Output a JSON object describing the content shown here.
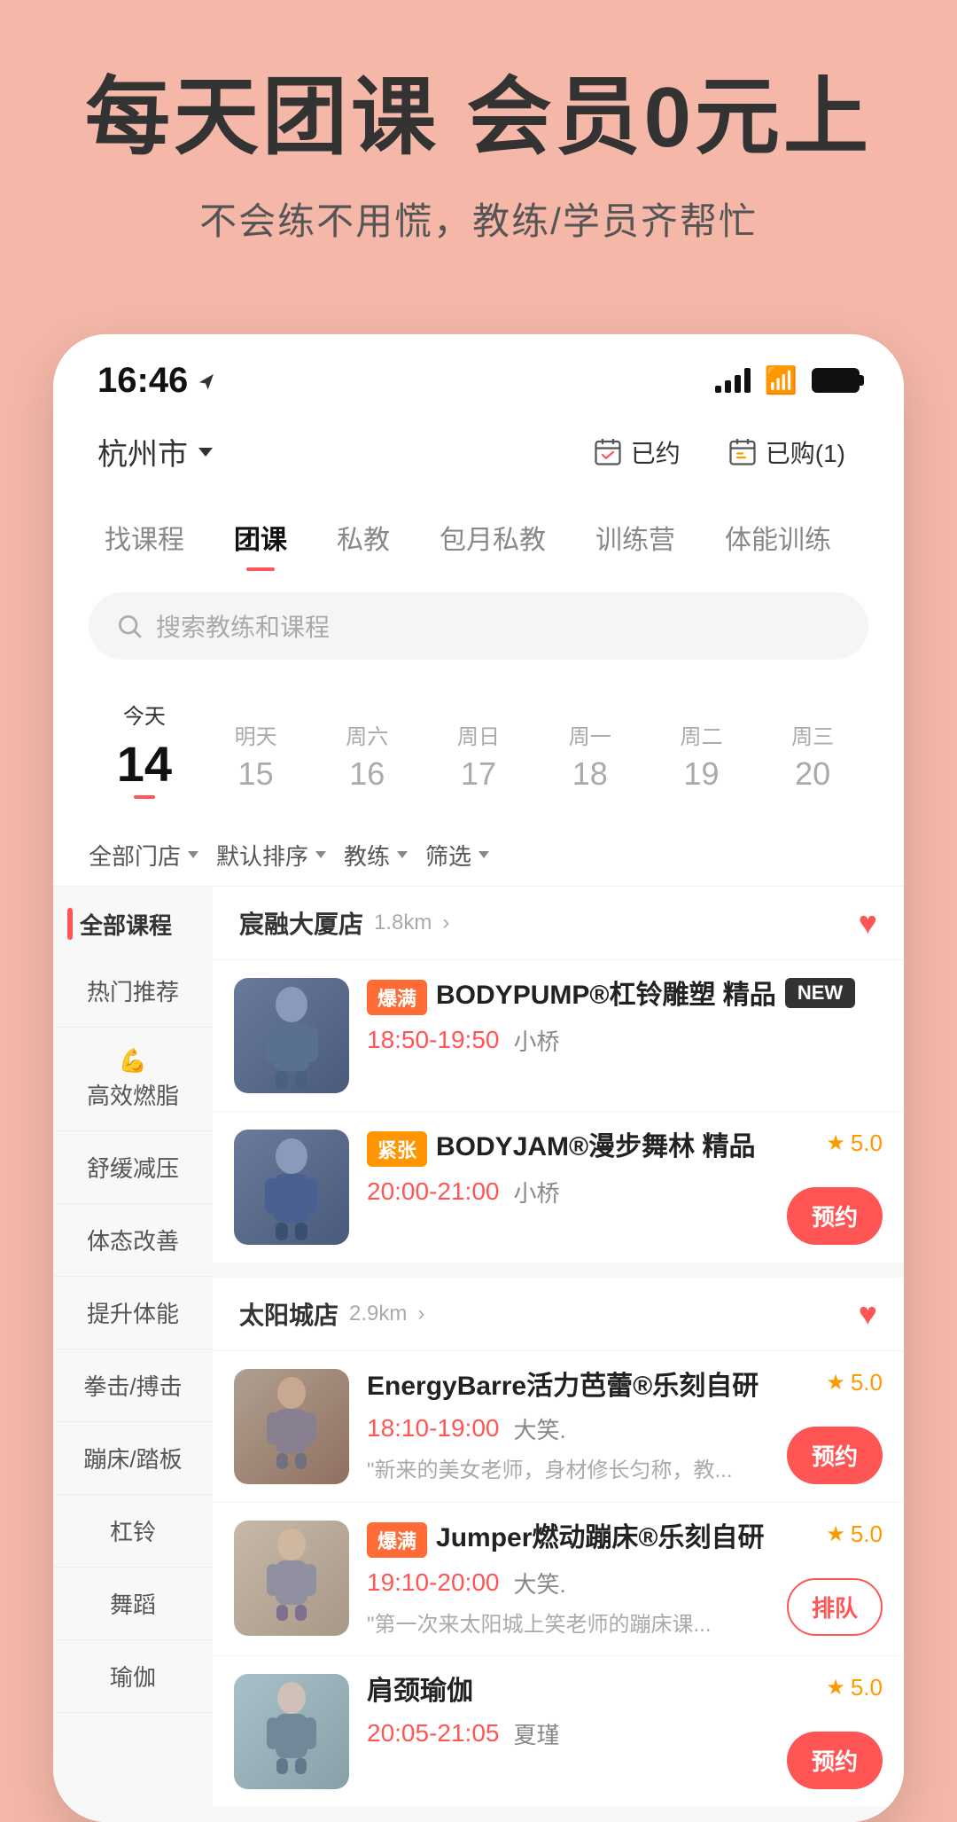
{
  "hero": {
    "title": "每天团课 会员0元上",
    "subtitle": "不会练不用慌，教练/学员齐帮忙"
  },
  "statusBar": {
    "time": "16:46",
    "location": "杭州市"
  },
  "navActions": {
    "booked": "已约",
    "purchased": "已购(1)"
  },
  "categoryTabs": [
    {
      "label": "找课程",
      "active": false
    },
    {
      "label": "团课",
      "active": true
    },
    {
      "label": "私教",
      "active": false
    },
    {
      "label": "包月私教",
      "active": false
    },
    {
      "label": "训练营",
      "active": false
    },
    {
      "label": "体能训练",
      "active": false
    }
  ],
  "search": {
    "placeholder": "搜索教练和课程"
  },
  "dates": [
    {
      "label": "今天",
      "num": "14",
      "today": true
    },
    {
      "label": "明天",
      "num": "15",
      "today": false
    },
    {
      "label": "周六",
      "num": "16",
      "today": false
    },
    {
      "label": "周日",
      "num": "17",
      "today": false
    },
    {
      "label": "周一",
      "num": "18",
      "today": false
    },
    {
      "label": "周二",
      "num": "19",
      "today": false
    },
    {
      "label": "周三",
      "num": "20",
      "today": false
    }
  ],
  "filters": [
    {
      "label": "全部门店"
    },
    {
      "label": "默认排序"
    },
    {
      "label": "教练"
    },
    {
      "label": "筛选"
    }
  ],
  "sidebar": {
    "header": "全部课程",
    "items": [
      {
        "label": "热门推荐",
        "emoji": ""
      },
      {
        "label": "高效燃脂",
        "emoji": "💪"
      },
      {
        "label": "舒缓减压",
        "emoji": ""
      },
      {
        "label": "体态改善",
        "emoji": ""
      },
      {
        "label": "提升体能",
        "emoji": ""
      },
      {
        "label": "拳击/搏击",
        "emoji": ""
      },
      {
        "label": "蹦床/踏板",
        "emoji": ""
      },
      {
        "label": "杠铃",
        "emoji": ""
      },
      {
        "label": "舞蹈",
        "emoji": ""
      },
      {
        "label": "瑜伽",
        "emoji": ""
      }
    ]
  },
  "stores": [
    {
      "name": "宸融大厦店",
      "distance": "1.8km",
      "liked": true,
      "courses": [
        {
          "tag": "爆满",
          "tagType": "hot",
          "isNew": true,
          "name": "BODYPUMP®杠铃雕塑 精品",
          "time": "18:50-19:50",
          "trainer": "小桥",
          "rating": null,
          "desc": "",
          "action": "none"
        },
        {
          "tag": "紧张",
          "tagType": "tense",
          "isNew": false,
          "name": "BODYJAM®漫步舞林 精品",
          "time": "20:00-21:00",
          "trainer": "小桥",
          "rating": "5.0",
          "desc": "",
          "action": "book"
        }
      ]
    },
    {
      "name": "太阳城店",
      "distance": "2.9km",
      "liked": true,
      "courses": [
        {
          "tag": "",
          "tagType": "none",
          "isNew": false,
          "name": "EnergyBarre活力芭蕾®乐刻自研",
          "time": "18:10-19:00",
          "trainer": "大笑.",
          "rating": "5.0",
          "desc": "\"新来的美女老师，身材修长匀称，教...",
          "action": "book"
        },
        {
          "tag": "爆满",
          "tagType": "hot",
          "isNew": false,
          "name": "Jumper燃动蹦床®乐刻自研",
          "time": "19:10-20:00",
          "trainer": "大笑.",
          "rating": "5.0",
          "desc": "\"第一次来太阳城上笑老师的蹦床课...",
          "action": "queue"
        },
        {
          "tag": "",
          "tagType": "none",
          "isNew": false,
          "name": "肩颈瑜伽",
          "time": "20:05-21:05",
          "trainer": "夏瑾",
          "rating": "5.0",
          "desc": "",
          "action": "book"
        }
      ]
    }
  ],
  "colors": {
    "primary": "#f55",
    "accent": "#ff6b35",
    "star": "#f90",
    "tense": "#ff9500"
  }
}
